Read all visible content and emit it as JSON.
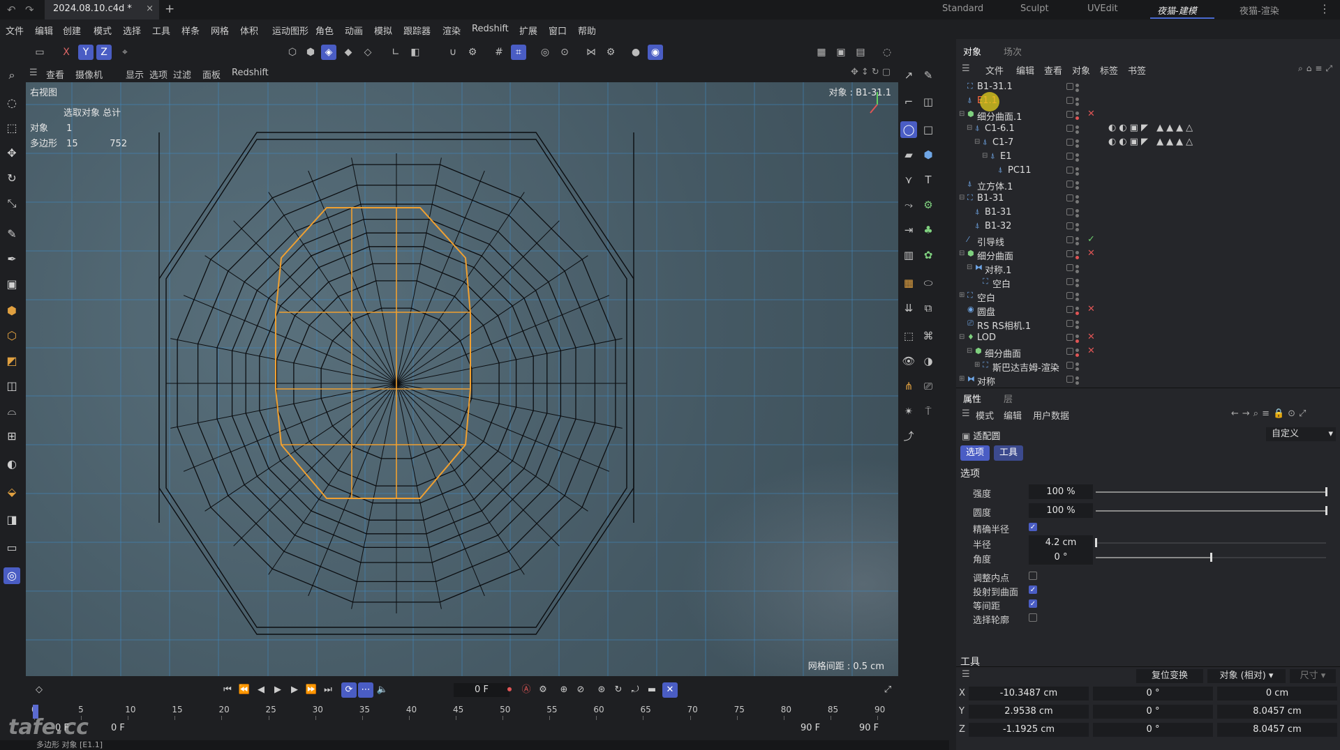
{
  "titlebar": {
    "document": "2024.08.10.c4d *",
    "close": "×",
    "new_tab": "+",
    "layouts": [
      "Standard",
      "Sculpt",
      "UVEdit",
      "夜猫-建模",
      "夜猫-渲染"
    ],
    "active_layout": "夜猫-建模"
  },
  "menubar": [
    "文件",
    "编辑",
    "创建",
    "模式",
    "选择",
    "工具",
    "样条",
    "网格",
    "体积",
    "运动图形",
    "角色",
    "动画",
    "模拟",
    "跟踪器",
    "渲染",
    "Redshift",
    "扩展",
    "窗口",
    "帮助"
  ],
  "toolbar": {
    "axes": [
      "X",
      "Y",
      "Z"
    ]
  },
  "viewport_menu": [
    "查看",
    "摄像机",
    "显示",
    "选项",
    "过滤",
    "面板",
    "Redshift"
  ],
  "viewport": {
    "name": "右视图",
    "stats_title": "选取对象 总计",
    "stats": [
      {
        "label": "对象",
        "selected": "1",
        "total": ""
      },
      {
        "label": "多边形",
        "selected": "15",
        "total": "752"
      }
    ],
    "object_info": "对象 : B1-31.1",
    "grid_spacing": "网格间距 : 0.5 cm"
  },
  "timeline": {
    "current_frame": "0 F",
    "ticks": [
      "0",
      "5",
      "10",
      "15",
      "20",
      "25",
      "30",
      "35",
      "40",
      "45",
      "50",
      "55",
      "60",
      "65",
      "70",
      "75",
      "80",
      "85",
      "90"
    ],
    "range_start": "0 F",
    "range_start2": "0 F",
    "range_end": "90 F",
    "range_end2": "90 F"
  },
  "status": "多边形 对象 [E1.1]",
  "watermark": "tafe.cc",
  "object_manager": {
    "tabs": [
      "对象",
      "场次"
    ],
    "menu": [
      "文件",
      "编辑",
      "查看",
      "对象",
      "标签",
      "书签"
    ],
    "rows": [
      {
        "name": "B1-31.1",
        "indent": 0,
        "icon": "null",
        "flag": ""
      },
      {
        "name": "E1.1",
        "indent": 0,
        "icon": "poly",
        "flag": "",
        "highlight": true
      },
      {
        "name": "细分曲面.1",
        "indent": 0,
        "icon": "subd",
        "flag": "x",
        "expand": "⊟"
      },
      {
        "name": "C1-6.1",
        "indent": 1,
        "icon": "poly",
        "flag": "",
        "expand": "⊟",
        "tags": "◐◐▣◤ ▲▲▲△"
      },
      {
        "name": "C1-7",
        "indent": 2,
        "icon": "poly",
        "flag": "",
        "expand": "⊟",
        "tags": "◐◐▣◤ ▲▲▲△"
      },
      {
        "name": "E1",
        "indent": 3,
        "icon": "poly",
        "flag": "",
        "expand": "⊟"
      },
      {
        "name": "PC11",
        "indent": 4,
        "icon": "poly",
        "flag": ""
      },
      {
        "name": "立方体.1",
        "indent": 0,
        "icon": "poly",
        "flag": ""
      },
      {
        "name": "B1-31",
        "indent": 0,
        "icon": "null",
        "flag": "",
        "expand": "⊟"
      },
      {
        "name": "B1-31",
        "indent": 1,
        "icon": "poly",
        "flag": ""
      },
      {
        "name": "B1-32",
        "indent": 1,
        "icon": "poly",
        "flag": ""
      },
      {
        "name": "引导线",
        "indent": 0,
        "icon": "spline",
        "flag": "✓"
      },
      {
        "name": "细分曲面",
        "indent": 0,
        "icon": "subd",
        "flag": "x",
        "expand": "⊟"
      },
      {
        "name": "对称.1",
        "indent": 1,
        "icon": "sym",
        "flag": "",
        "expand": "⊟"
      },
      {
        "name": "空白",
        "indent": 2,
        "icon": "null",
        "flag": ""
      },
      {
        "name": "空白",
        "indent": 0,
        "icon": "null",
        "flag": "",
        "expand": "⊞"
      },
      {
        "name": "圆盘",
        "indent": 0,
        "icon": "disc",
        "flag": "x"
      },
      {
        "name": "RS RS相机.1",
        "indent": 0,
        "icon": "cam",
        "flag": ""
      },
      {
        "name": "LOD",
        "indent": 0,
        "icon": "lod",
        "flag": "x",
        "expand": "⊟"
      },
      {
        "name": "细分曲面",
        "indent": 1,
        "icon": "subd",
        "flag": "x",
        "expand": "⊟"
      },
      {
        "name": "斯巴达吉姆-渲染",
        "indent": 2,
        "icon": "null",
        "flag": "",
        "expand": "⊞"
      },
      {
        "name": "对称",
        "indent": 0,
        "icon": "sym",
        "flag": "",
        "expand": "⊞"
      }
    ]
  },
  "attributes": {
    "tabs": [
      "属性",
      "层"
    ],
    "menu": [
      "模式",
      "编辑",
      "用户数据"
    ],
    "object": "适配圆",
    "preset": "自定义",
    "buttons": [
      "选项",
      "工具"
    ],
    "section": "选项",
    "section2": "工具",
    "props": [
      {
        "label": "强度",
        "value": "100 %",
        "type": "slider",
        "pct": 1.0
      },
      {
        "label": "圆度",
        "value": "100 %",
        "type": "slider",
        "pct": 1.0
      },
      {
        "label": "精确半径",
        "type": "check",
        "checked": true
      },
      {
        "label": "半径",
        "value": "4.2 cm",
        "type": "slider",
        "pct": 0.0
      },
      {
        "label": "角度",
        "value": "0 °",
        "type": "slider",
        "pct": 0.5
      },
      {
        "label": "调整内点",
        "type": "check",
        "checked": false
      },
      {
        "label": "投射到曲面",
        "type": "check",
        "checked": true
      },
      {
        "label": "等间距",
        "type": "check",
        "checked": true
      },
      {
        "label": "选择轮廓",
        "type": "check",
        "checked": false
      }
    ]
  },
  "coordinates": {
    "reset": "复位变换",
    "mode": "对象 (相对)",
    "size": "尺寸",
    "rows": [
      {
        "axis": "X",
        "pos": "-10.3487 cm",
        "rot": "0 °",
        "size": "0 cm"
      },
      {
        "axis": "Y",
        "pos": "2.9538 cm",
        "rot": "0 °",
        "size": "8.0457 cm"
      },
      {
        "axis": "Z",
        "pos": "-1.1925 cm",
        "rot": "0 °",
        "size": "8.0457 cm"
      }
    ]
  },
  "colors": {
    "accent": "#4a5dc4",
    "selection": "#f0a030",
    "wire": "#0b0d10",
    "grid": "#3f8cc8"
  }
}
